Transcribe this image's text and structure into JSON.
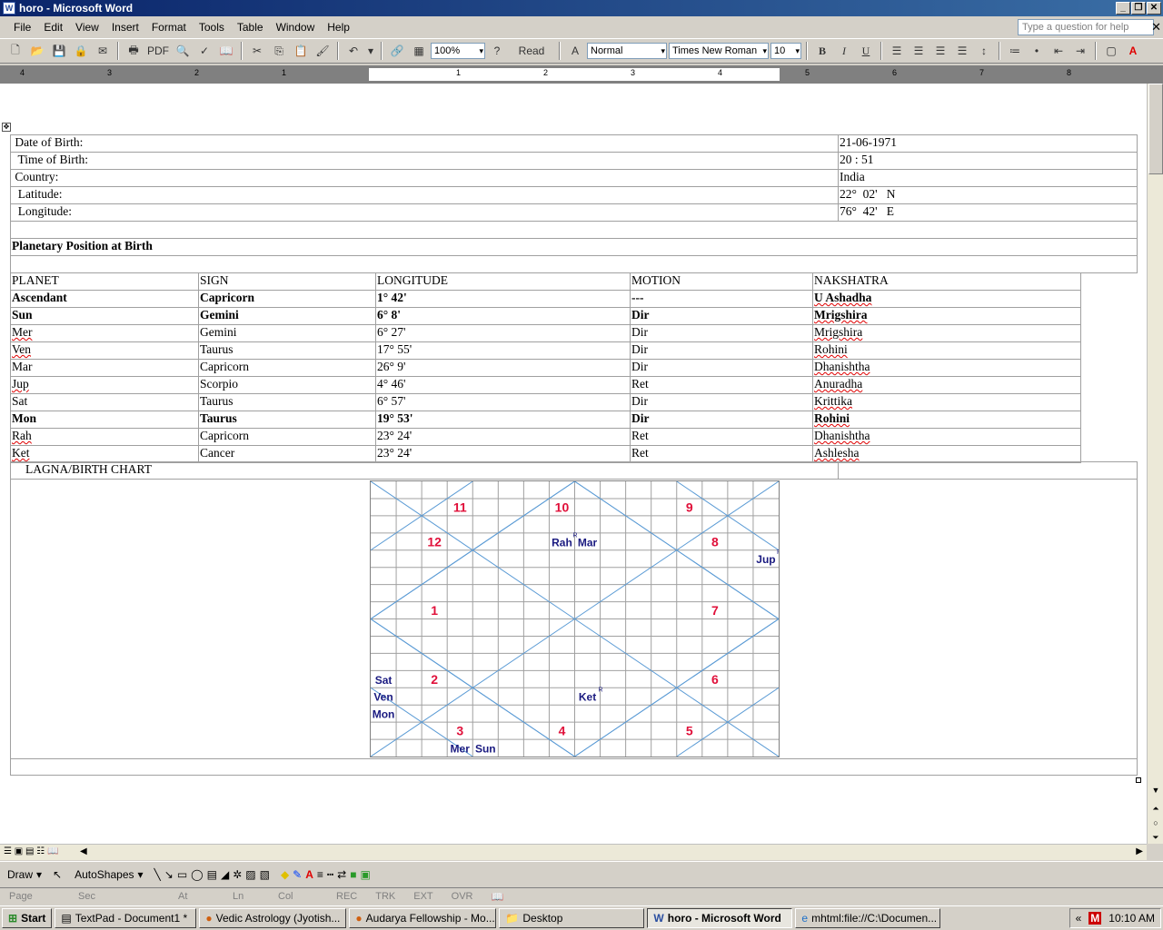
{
  "window": {
    "title": "horo - Microsoft Word"
  },
  "menu": {
    "items": [
      "File",
      "Edit",
      "View",
      "Insert",
      "Format",
      "Tools",
      "Table",
      "Window",
      "Help"
    ],
    "help_placeholder": "Type a question for help"
  },
  "toolbar": {
    "pdf_label": "PDF",
    "zoom": "100%",
    "read_label": "Read",
    "style": "Normal",
    "font": "Times New Roman",
    "size": "10"
  },
  "ruler": {
    "labels": [
      "4",
      "3",
      "2",
      "1",
      "1",
      "2",
      "3",
      "4",
      "5",
      "6",
      "7",
      "8"
    ]
  },
  "birth": {
    "rows": [
      {
        "label": " Date of Birth:",
        "value": "21-06-1971"
      },
      {
        "label": "  Time of Birth:",
        "value": "20 : 51"
      },
      {
        "label": " Country:",
        "value": "India"
      },
      {
        "label": "  Latitude:",
        "value": "22°  02'   N"
      },
      {
        "label": "  Longitude:",
        "value": "76°  42'   E"
      }
    ]
  },
  "section_title": "Planetary Position at Birth",
  "planets": {
    "headers": [
      "PLANET",
      "SIGN",
      "LONGITUDE",
      "MOTION",
      "NAKSHATRA"
    ],
    "rows": [
      {
        "cells": [
          "Ascendant",
          "Capricorn",
          "1° 42'",
          "---",
          "U Ashadha"
        ],
        "bold": true
      },
      {
        "cells": [
          "Sun",
          "Gemini",
          "6° 8'",
          "Dir",
          "Mrigshira"
        ],
        "bold": true
      },
      {
        "cells": [
          "Mer",
          "Gemini",
          "6° 27'",
          "Dir",
          "Mrigshira"
        ],
        "bold": false
      },
      {
        "cells": [
          "Ven",
          "Taurus",
          "17° 55'",
          "Dir",
          "Rohini"
        ],
        "bold": false
      },
      {
        "cells": [
          "Mar",
          "Capricorn",
          "26° 9'",
          "Dir",
          "Dhanishtha"
        ],
        "bold": false
      },
      {
        "cells": [
          "Jup",
          "Scorpio",
          "4° 46'",
          "Ret",
          "Anuradha"
        ],
        "bold": false
      },
      {
        "cells": [
          "Sat",
          "Taurus",
          "6° 57'",
          "Dir",
          "Krittika"
        ],
        "bold": false
      },
      {
        "cells": [
          "Mon",
          "Taurus",
          "19° 53'",
          "Dir",
          "Rohini"
        ],
        "bold": true
      },
      {
        "cells": [
          "Rah",
          "Capricorn",
          "23° 24'",
          "Ret",
          "Dhanishtha"
        ],
        "bold": false
      },
      {
        "cells": [
          "Ket",
          "Cancer",
          "23° 24'",
          "Ret",
          "Ashlesha"
        ],
        "bold": false
      }
    ]
  },
  "chart_title": "LAGNA/BIRTH CHART",
  "chart": {
    "house_color": "#e0103a",
    "planet_color": "#1a1a80",
    "grid_color": "#a0a0a0",
    "diag_color": "#5b9bd5",
    "houses": [
      "11",
      "10",
      "9",
      "12",
      "8",
      "1",
      "7",
      "2",
      "6",
      "3",
      "4",
      "5"
    ],
    "planets": [
      "Rah",
      "Mar",
      "Jup",
      "Sat",
      "Ven",
      "Mon",
      "Ket",
      "Mer",
      "Sun"
    ],
    "retro_mark": "R"
  },
  "drawbar": {
    "draw": "Draw",
    "autoshapes": "AutoShapes"
  },
  "status": [
    "Page",
    "Sec",
    "At",
    "Ln",
    "Col",
    "REC",
    "TRK",
    "EXT",
    "OVR"
  ],
  "taskbar": {
    "start": "Start",
    "tasks": [
      {
        "label": "TextPad - Document1 *",
        "active": false
      },
      {
        "label": "Vedic Astrology (Jyotish...",
        "active": false
      },
      {
        "label": "Audarya Fellowship - Mo...",
        "active": false
      },
      {
        "label": "Desktop",
        "active": false
      },
      {
        "label": "horo - Microsoft Word",
        "active": true
      },
      {
        "label": "mhtml:file://C:\\Documen...",
        "active": false
      }
    ],
    "clock": "10:10 AM"
  }
}
